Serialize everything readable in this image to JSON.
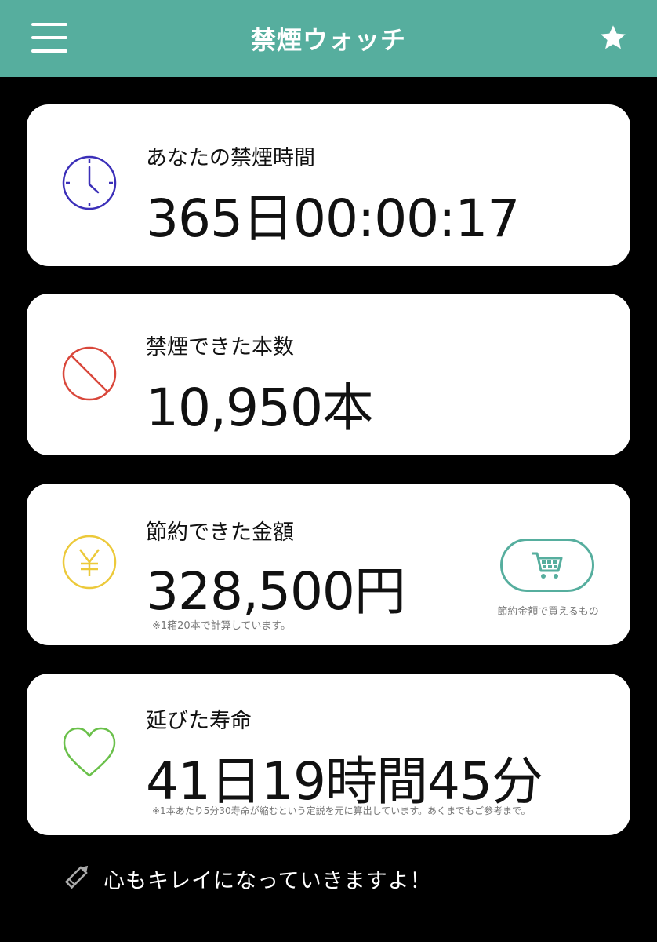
{
  "header": {
    "title": "禁煙ウォッチ",
    "menu_icon": "hamburger-menu-icon",
    "favorite_icon": "star-icon"
  },
  "cards": {
    "time": {
      "label": "あなたの禁煙時間",
      "value": "365日00:00:17",
      "icon": "clock-icon",
      "icon_color": "#3b2fb8"
    },
    "cigarettes": {
      "label": "禁煙できた本数",
      "value": "10,950本",
      "icon": "prohibited-icon",
      "icon_color": "#d9473b"
    },
    "money": {
      "label": "節約できた金額",
      "value": "328,500円",
      "note": "※1箱20本で計算しています。",
      "icon": "yen-icon",
      "icon_color": "#ecc93a",
      "shop_button_icon": "shopping-cart-icon",
      "shop_caption": "節約金額で買えるもの"
    },
    "life": {
      "label": "延びた寿命",
      "value": "41日19時間45分",
      "note": "※1本あたり5分30寿命が縮むという定説を元に算出しています。あくまでもご参考まで。",
      "icon": "heart-icon",
      "icon_color": "#6ac04a"
    }
  },
  "footer": {
    "icon": "pencil-icon",
    "message": "心もキレイになっていきますよ！"
  },
  "colors": {
    "accent": "#56ae9e",
    "background": "#000000",
    "card": "#ffffff"
  }
}
